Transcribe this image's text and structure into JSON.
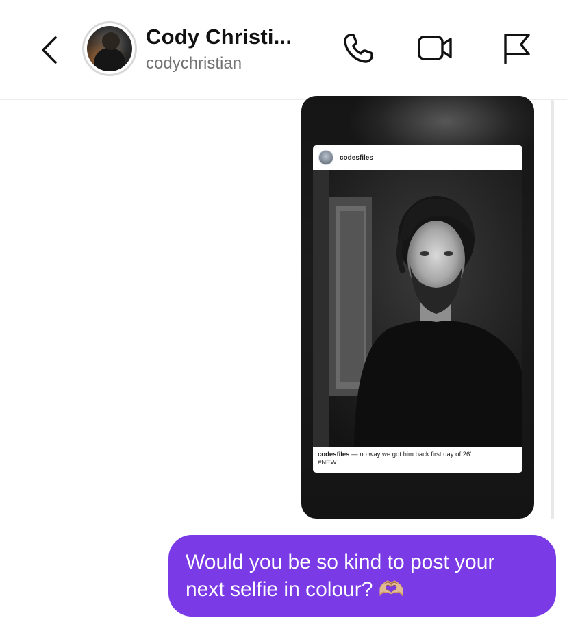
{
  "header": {
    "contact_name": "Cody Christi...",
    "contact_handle": "codychristian",
    "icons": {
      "back": "chevron-left-icon",
      "call": "phone-icon",
      "video": "video-camera-icon",
      "report": "flag-icon"
    }
  },
  "shared_post": {
    "username": "codesfiles",
    "caption_user": "codesfiles",
    "caption_text": " — no way we got him back first day of 26'",
    "caption_tag": "#NEW..."
  },
  "message": {
    "text_line1": "Would you be so kind to post your",
    "text_line2": "next selfie in colour? 🫶🏼",
    "bubble_color": "#7a3be6"
  },
  "colors": {
    "accent": "#7a3be6",
    "secondary_text": "#737373",
    "card_background": "#151515"
  }
}
